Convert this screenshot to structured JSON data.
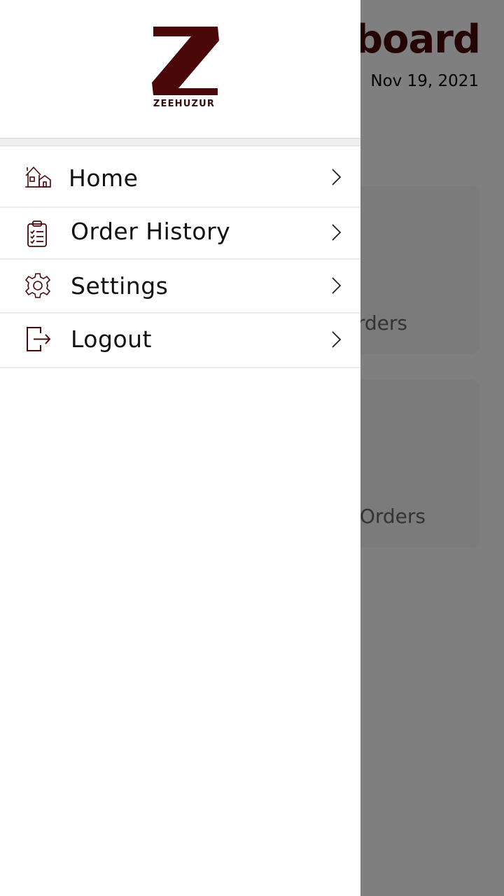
{
  "dashboard": {
    "title": "board",
    "date": "Nov 19, 2021",
    "cards": [
      {
        "label": "rders"
      },
      {
        "label": "Orders"
      }
    ]
  },
  "drawer": {
    "brand": {
      "logo_letter": "Z",
      "name": "ZEEHUZUR",
      "color": "#4a0808"
    },
    "menu": [
      {
        "label": "Home",
        "icon": "home-icon"
      },
      {
        "label": "Order History",
        "icon": "clipboard-list-icon"
      },
      {
        "label": "Settings",
        "icon": "gear-icon"
      },
      {
        "label": "Logout",
        "icon": "logout-icon"
      }
    ]
  },
  "colors": {
    "accent": "#4a0808",
    "scrim": "#7f7f7f"
  }
}
